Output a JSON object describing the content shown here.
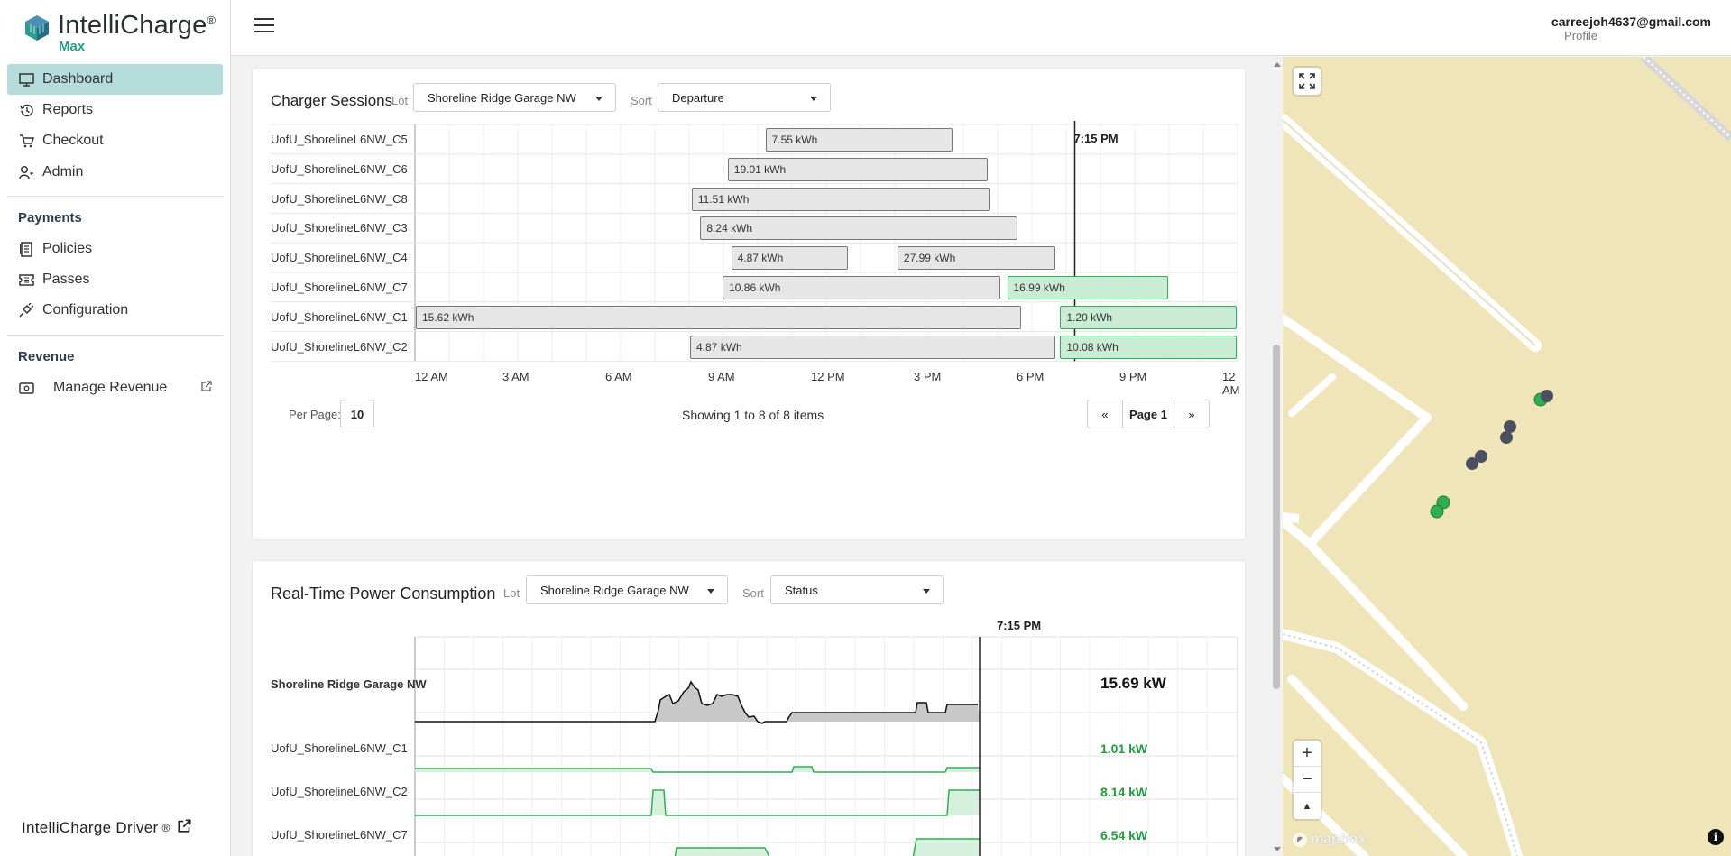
{
  "app": {
    "brand_name": "IntelliCharge",
    "brand_reg": "®",
    "brand_sub": "Max"
  },
  "sidebar": {
    "items": [
      {
        "label": "Dashboard",
        "icon": "monitor-icon"
      },
      {
        "label": "Reports",
        "icon": "history-icon"
      },
      {
        "label": "Checkout",
        "icon": "cart-icon"
      },
      {
        "label": "Admin",
        "icon": "user-key-icon"
      }
    ],
    "payments_title": "Payments",
    "payments_items": [
      {
        "label": "Policies",
        "icon": "document-icon"
      },
      {
        "label": "Passes",
        "icon": "ticket-icon"
      },
      {
        "label": "Configuration",
        "icon": "plug-icon"
      }
    ],
    "revenue_title": "Revenue",
    "revenue_items": [
      {
        "label": "Manage Revenue",
        "icon": "cash-icon"
      }
    ],
    "driver_link": "IntelliCharge Driver",
    "driver_reg": "®"
  },
  "header": {
    "user_email": "carreejoh4637@gmail.com",
    "profile_label": "Profile"
  },
  "sessions": {
    "title": "Charger Sessions",
    "lot_label": "Lot",
    "lot_value": "Shoreline Ridge Garage NW",
    "sort_label": "Sort",
    "sort_value": "Departure",
    "now_label": "7:15 PM",
    "now_hour": 19.25,
    "ticks": [
      "12 AM",
      "3 AM",
      "6 AM",
      "9 AM",
      "12 PM",
      "3 PM",
      "6 PM",
      "9 PM",
      "12 AM"
    ],
    "rows": [
      {
        "name": "UofU_ShorelineL6NW_C5",
        "sessions": [
          {
            "start": 10.2,
            "end": 15.7,
            "label": "7.55 kWh",
            "active": false
          }
        ]
      },
      {
        "name": "UofU_ShorelineL6NW_C6",
        "sessions": [
          {
            "start": 9.1,
            "end": 16.75,
            "label": "19.01 kWh",
            "active": false
          }
        ]
      },
      {
        "name": "UofU_ShorelineL6NW_C8",
        "sessions": [
          {
            "start": 8.05,
            "end": 16.8,
            "label": "11.51 kWh",
            "active": false
          }
        ]
      },
      {
        "name": "UofU_ShorelineL6NW_C3",
        "sessions": [
          {
            "start": 8.3,
            "end": 17.6,
            "label": "8.24 kWh",
            "active": false
          }
        ]
      },
      {
        "name": "UofU_ShorelineL6NW_C4",
        "sessions": [
          {
            "start": 9.2,
            "end": 12.65,
            "label": "4.87 kWh",
            "active": false
          },
          {
            "start": 14.05,
            "end": 18.7,
            "label": "27.99 kWh",
            "active": false
          }
        ]
      },
      {
        "name": "UofU_ShorelineL6NW_C7",
        "sessions": [
          {
            "start": 8.95,
            "end": 17.1,
            "label": "10.86 kWh",
            "active": false
          },
          {
            "start": 17.25,
            "end": 22.0,
            "label": "16.99 kWh",
            "active": true
          }
        ]
      },
      {
        "name": "UofU_ShorelineL6NW_C1",
        "sessions": [
          {
            "start": 0.0,
            "end": 17.7,
            "label": "15.62 kWh",
            "active": false
          },
          {
            "start": 18.8,
            "end": 24.0,
            "label": "1.20 kWh",
            "active": true
          }
        ]
      },
      {
        "name": "UofU_ShorelineL6NW_C2",
        "sessions": [
          {
            "start": 8.0,
            "end": 18.7,
            "label": "4.87 kWh",
            "active": false
          },
          {
            "start": 18.8,
            "end": 24.0,
            "label": "10.08 kWh",
            "active": true
          }
        ]
      }
    ],
    "per_page_label": "Per Page:",
    "per_page_value": "10",
    "showing": "Showing 1 to 8 of 8 items",
    "page_prev": "«",
    "page_label": "Page 1",
    "page_next": "»"
  },
  "power": {
    "title": "Real-Time Power Consumption",
    "lot_label": "Lot",
    "lot_value": "Shoreline Ridge Garage NW",
    "sort_label": "Sort",
    "sort_value": "Status",
    "now_label": "7:15 PM",
    "rows": [
      {
        "name": "Shoreline Ridge Garage NW",
        "value": "15.69 kW",
        "total": true
      },
      {
        "name": "UofU_ShorelineL6NW_C1",
        "value": "1.01 kW",
        "total": false
      },
      {
        "name": "UofU_ShorelineL6NW_C2",
        "value": "8.14 kW",
        "total": false
      },
      {
        "name": "UofU_ShorelineL6NW_C7",
        "value": "6.54 kW",
        "total": false
      }
    ]
  },
  "map": {
    "attribution": "mapbox",
    "zoom_in": "+",
    "zoom_out": "−",
    "compass": "▲",
    "info": "i"
  },
  "colors": {
    "accent": "#b3dcdb",
    "active_green": "#2db052",
    "inactive_gray": "#e6e6e7"
  }
}
